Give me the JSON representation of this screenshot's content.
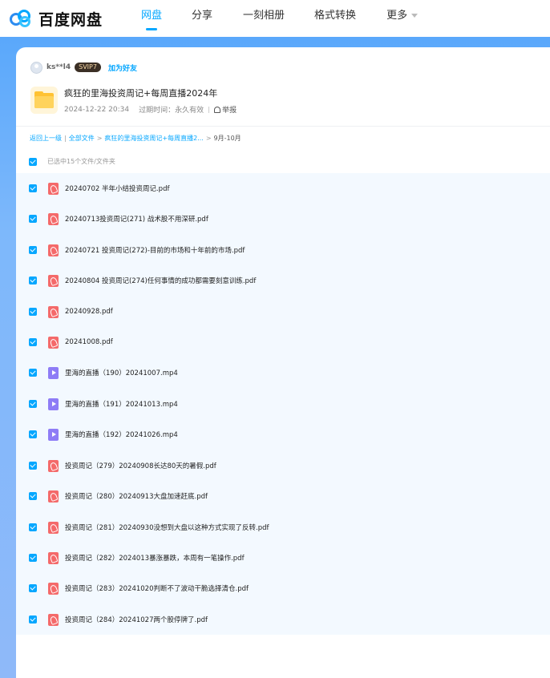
{
  "brand": {
    "name": "百度网盘"
  },
  "nav": [
    {
      "label": "网盘",
      "active": true
    },
    {
      "label": "分享"
    },
    {
      "label": "一刻相册"
    },
    {
      "label": "格式转换"
    },
    {
      "label": "更多"
    }
  ],
  "sharer": {
    "name": "ks**l4",
    "badge": "SVIP7",
    "add_friend": "加为好友"
  },
  "share": {
    "title": "疯狂的里海投资周记+每周直播2024年",
    "date": "2024-12-22 20:34",
    "expiry_label": "过期时间：永久有效",
    "report": "举报"
  },
  "breadcrumb": {
    "back": "返回上一级",
    "all": "全部文件",
    "folder": "疯狂的里海投资周记+每周直播2...",
    "current": "9月-10月",
    "sep": ">",
    "pipe": "|"
  },
  "selection": {
    "text": "已选中15个文件/文件夹"
  },
  "files": [
    {
      "name": "20240702 半年小结投资周记.pdf",
      "type": "pdf"
    },
    {
      "name": "20240713投资周记(271) 战术股不用深研.pdf",
      "type": "pdf"
    },
    {
      "name": "20240721 投资周记(272)-目前的市场和十年前的市场.pdf",
      "type": "pdf"
    },
    {
      "name": "20240804 投资周记(274)任何事情的成功都需要刻意训练.pdf",
      "type": "pdf"
    },
    {
      "name": "20240928.pdf",
      "type": "pdf"
    },
    {
      "name": "20241008.pdf",
      "type": "pdf"
    },
    {
      "name": "里海的直播（190）20241007.mp4",
      "type": "mp4"
    },
    {
      "name": "里海的直播（191）20241013.mp4",
      "type": "mp4"
    },
    {
      "name": "里海的直播（192）20241026.mp4",
      "type": "mp4"
    },
    {
      "name": "投资周记（279）20240908长达80天的暑假.pdf",
      "type": "pdf"
    },
    {
      "name": "投资周记（280）20240913大盘加速赶底.pdf",
      "type": "pdf"
    },
    {
      "name": "投资周记（281）20240930没想到大盘以这种方式实现了反转.pdf",
      "type": "pdf"
    },
    {
      "name": "投资周记（282）2024013暴涨暴跌，本周有一笔操作.pdf",
      "type": "pdf"
    },
    {
      "name": "投资周记（283）20241020判断不了波动干脆选择清仓.pdf",
      "type": "pdf"
    },
    {
      "name": "投资周记（284）20241027两个股停牌了.pdf",
      "type": "pdf"
    }
  ]
}
